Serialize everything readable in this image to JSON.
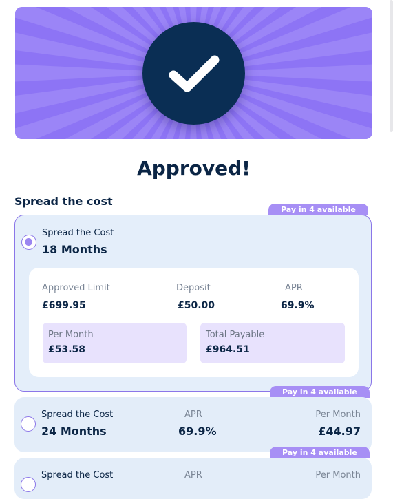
{
  "header": {
    "title": "Approved!"
  },
  "section": {
    "heading": "Spread the cost"
  },
  "badge_label": "Pay in 4 available",
  "options": [
    {
      "label": "Spread the Cost",
      "term": "18 Months",
      "selected": true,
      "details": {
        "approved_limit_label": "Approved Limit",
        "approved_limit": "£699.95",
        "deposit_label": "Deposit",
        "deposit": "£50.00",
        "apr_label": "APR",
        "apr": "69.9%",
        "per_month_label": "Per Month",
        "per_month": "£53.58",
        "total_payable_label": "Total Payable",
        "total_payable": "£964.51"
      }
    },
    {
      "label": "Spread the Cost",
      "term": "24 Months",
      "selected": false,
      "apr_label": "APR",
      "apr": "69.9%",
      "per_month_label": "Per Month",
      "per_month": "£44.97"
    },
    {
      "label": "Spread the Cost",
      "selected": false,
      "apr_label": "APR",
      "per_month_label": "Per Month"
    }
  ],
  "icons": {
    "success": "checkmark-icon"
  },
  "colors": {
    "banner": "#8d74f5",
    "check_circle": "#0a2e54",
    "accent": "#a78ff5",
    "card_bg": "#e3edf9",
    "text_dark": "#0b2545"
  }
}
